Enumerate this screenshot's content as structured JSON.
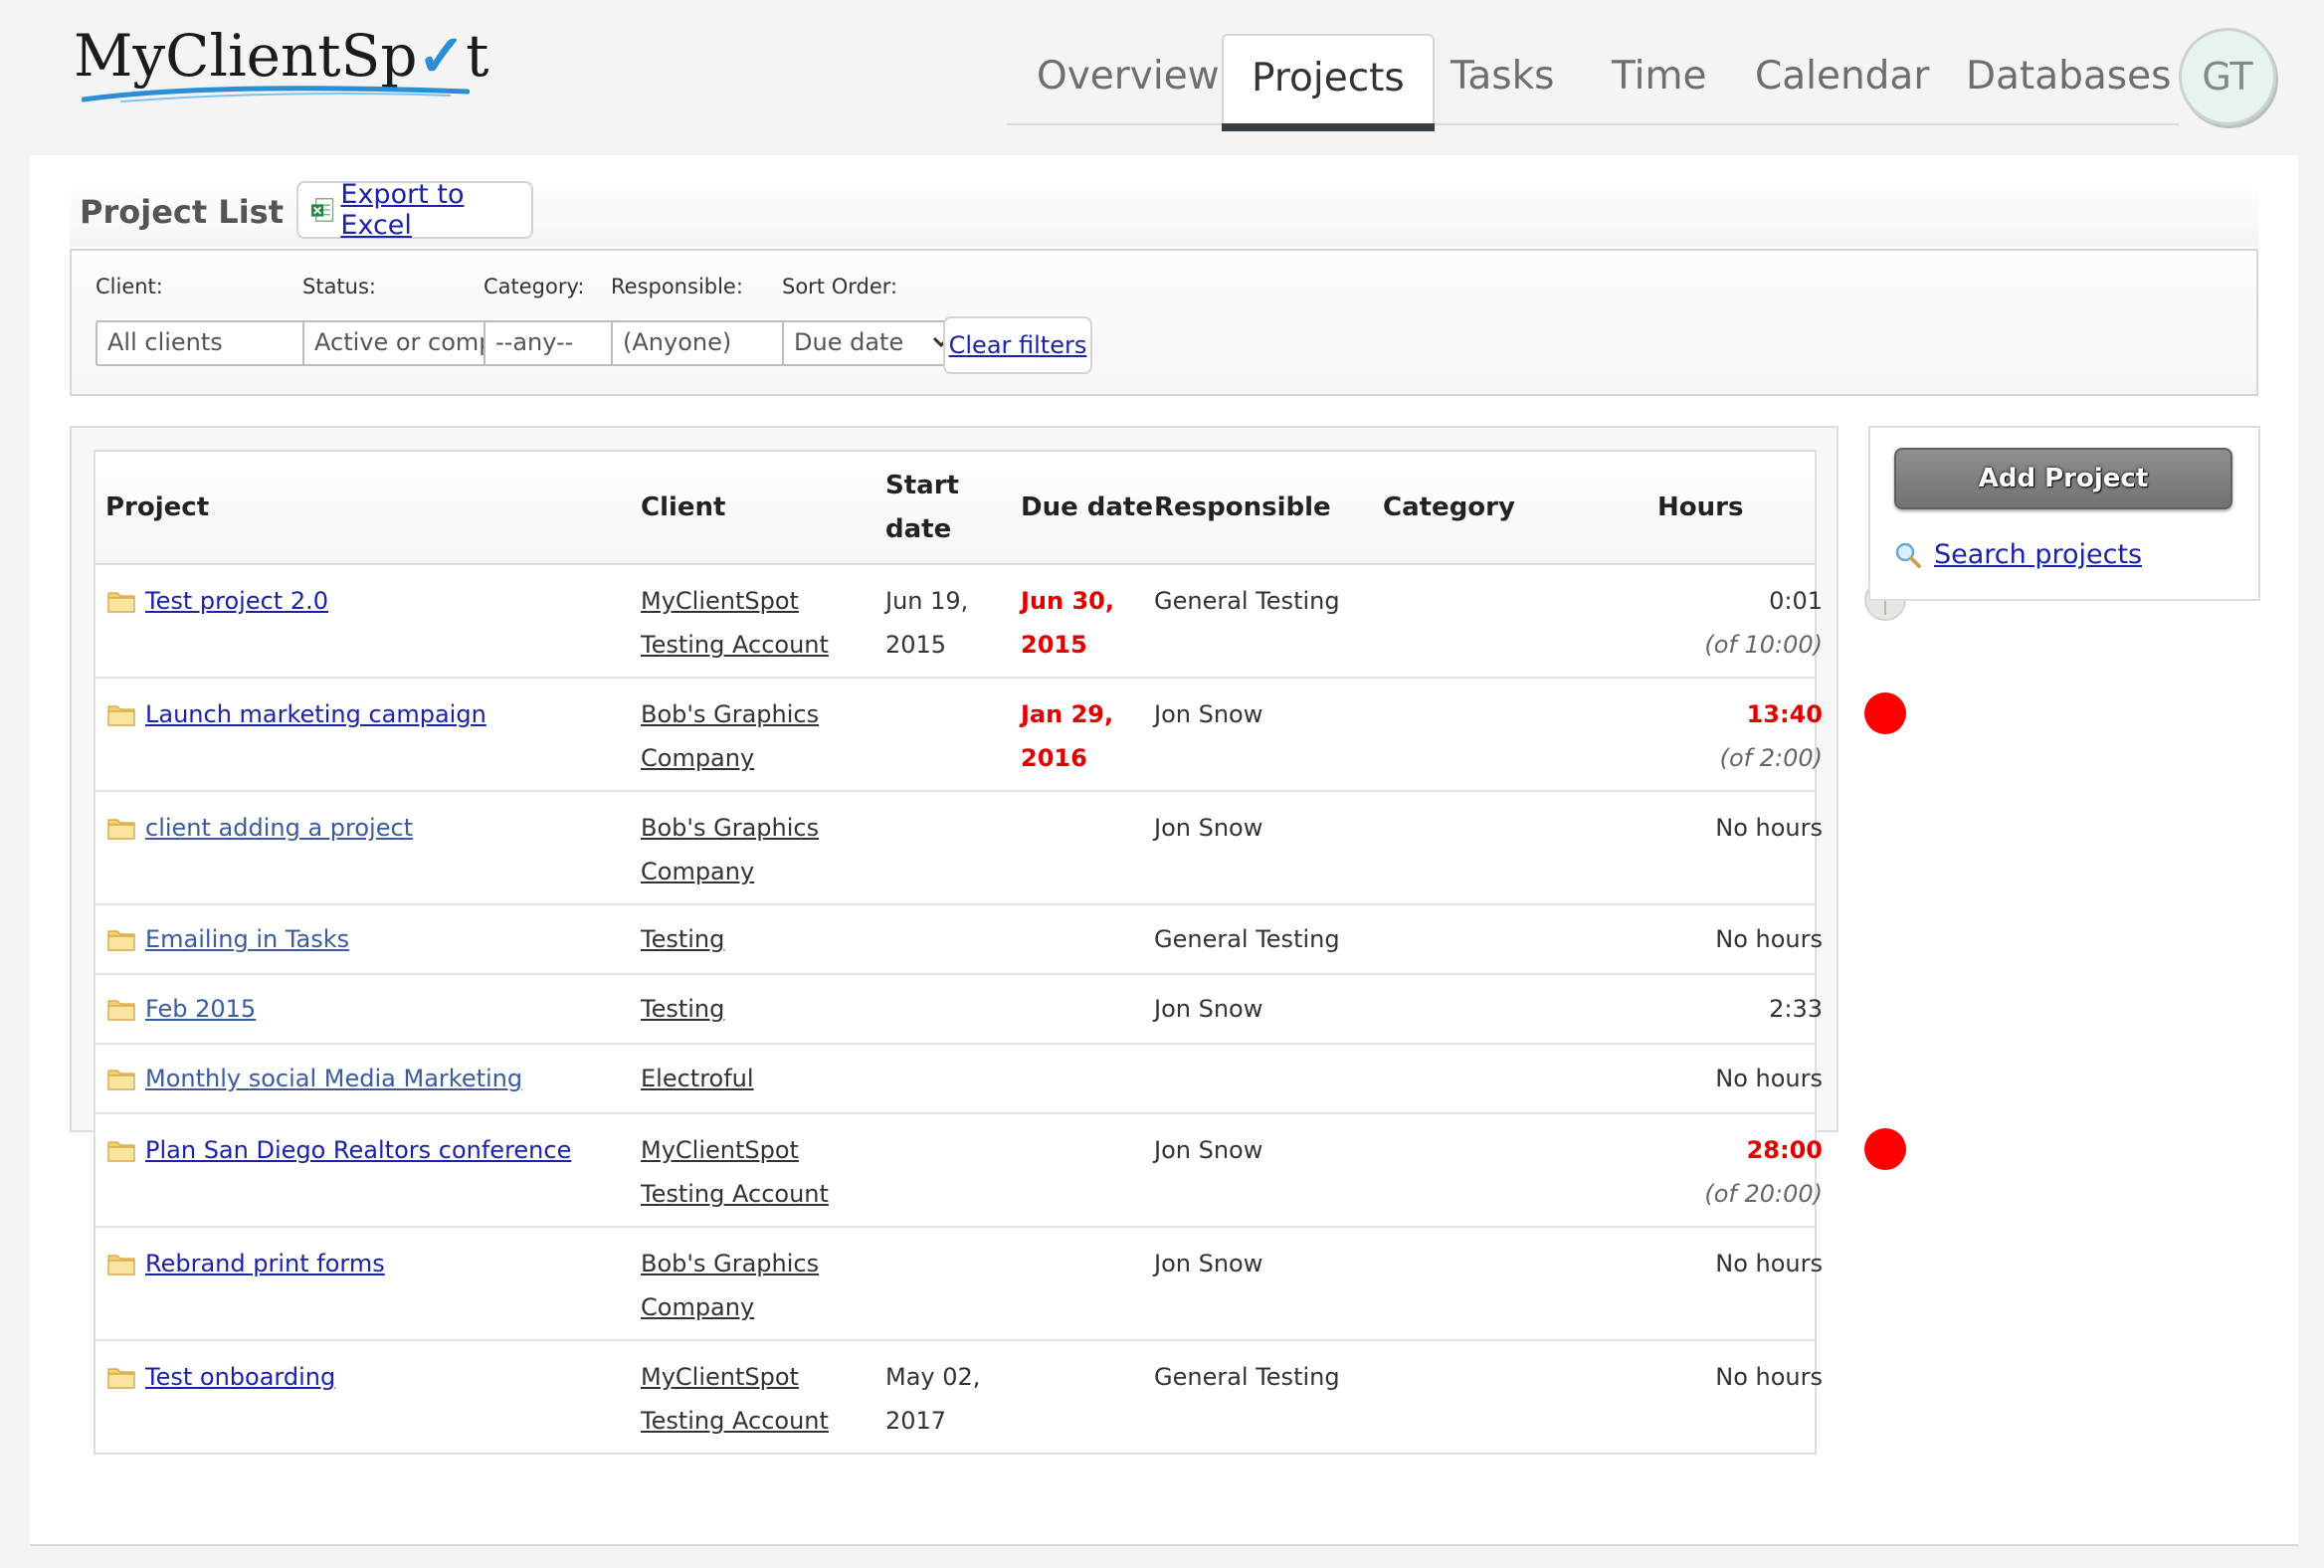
{
  "app": {
    "logo_text": "MyClientSp",
    "logo_tail": "t"
  },
  "nav": {
    "tabs": [
      {
        "label": "Overview"
      },
      {
        "label": "Projects",
        "active": true
      },
      {
        "label": "Tasks"
      },
      {
        "label": "Time"
      },
      {
        "label": "Calendar"
      },
      {
        "label": "Databases"
      }
    ],
    "avatar": "GT"
  },
  "list": {
    "title": "Project List",
    "export_label": "Export to Excel"
  },
  "filters": {
    "client": {
      "label": "Client:",
      "value": "All clients"
    },
    "status": {
      "label": "Status:",
      "value": "Active or completed"
    },
    "category": {
      "label": "Category:",
      "value": "--any--"
    },
    "responsible": {
      "label": "Responsible:",
      "value": "(Anyone)"
    },
    "sort": {
      "label": "Sort Order:",
      "value": "Due date"
    },
    "clear_label": "Clear filters"
  },
  "table": {
    "headers": {
      "project": "Project",
      "client": "Client",
      "start_line1": "Start",
      "start_line2": "date",
      "due": "Due date",
      "responsible": "Responsible",
      "category": "Category",
      "hours": "Hours"
    },
    "rows": [
      {
        "project": "Test project 2.0",
        "client1": "MyClientSpot",
        "client2": "Testing Account",
        "start1": "Jun 19,",
        "start2": "2015",
        "due1": "Jun 30,",
        "due2": "2015",
        "responsible": "General Testing",
        "category": "",
        "hours": "0:01",
        "hours_sub": "(of 10:00)"
      },
      {
        "project": "Launch marketing campaign",
        "client1": "Bob's Graphics",
        "client2": "Company",
        "start1": "",
        "start2": "",
        "due1": "Jan 29,",
        "due2": "2016",
        "responsible": "Jon Snow",
        "category": "",
        "hours": "13:40",
        "hours_sub": "(of 2:00)"
      },
      {
        "project": "client adding a project",
        "client1": "Bob's Graphics",
        "client2": "Company",
        "start1": "",
        "start2": "",
        "due1": "",
        "due2": "",
        "responsible": "Jon Snow",
        "category": "",
        "hours": "No hours",
        "hours_sub": ""
      },
      {
        "project": "Emailing in Tasks",
        "client1": "Testing",
        "client2": "",
        "start1": "",
        "start2": "",
        "due1": "",
        "due2": "",
        "responsible": "General Testing",
        "category": "",
        "hours": "No hours",
        "hours_sub": ""
      },
      {
        "project": "Feb 2015",
        "client1": "Testing",
        "client2": "",
        "start1": "",
        "start2": "",
        "due1": "",
        "due2": "",
        "responsible": "Jon Snow",
        "category": "",
        "hours": "2:33",
        "hours_sub": ""
      },
      {
        "project": "Monthly social Media Marketing",
        "client1": "Electroful",
        "client2": "",
        "start1": "",
        "start2": "",
        "due1": "",
        "due2": "",
        "responsible": "",
        "category": "",
        "hours": "No hours",
        "hours_sub": ""
      },
      {
        "project": "Plan San Diego Realtors conference",
        "client1": "MyClientSpot",
        "client2": "Testing Account",
        "start1": "",
        "start2": "",
        "due1": "",
        "due2": "",
        "responsible": "Jon Snow",
        "category": "",
        "hours": "28:00",
        "hours_sub": "(of 20:00)"
      },
      {
        "project": "Rebrand print forms",
        "client1": "Bob's Graphics",
        "client2": "Company",
        "start1": "",
        "start2": "",
        "due1": "",
        "due2": "",
        "responsible": "Jon Snow",
        "category": "",
        "hours": "No hours",
        "hours_sub": ""
      },
      {
        "project": "Test onboarding",
        "client1": "MyClientSpot",
        "client2": "Testing Account",
        "start1": "May 02,",
        "start2": "2017",
        "due1": "",
        "due2": "",
        "responsible": "General Testing",
        "category": "",
        "hours": "No hours",
        "hours_sub": ""
      }
    ]
  },
  "sidebar": {
    "add_label": "Add Project",
    "search_label": "Search projects"
  }
}
